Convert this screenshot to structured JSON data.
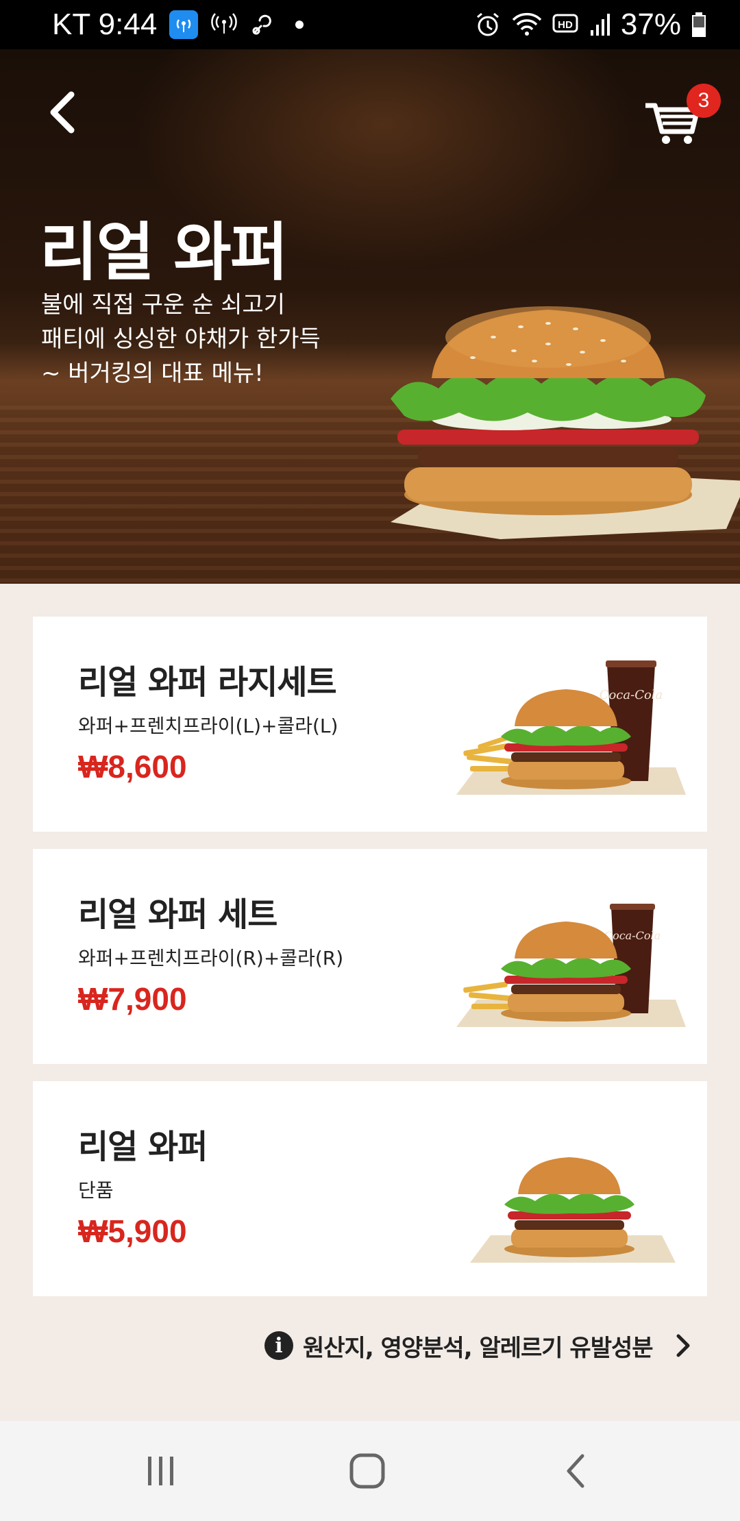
{
  "status_bar": {
    "carrier_time": "KT 9:44",
    "battery": "37%"
  },
  "header": {
    "cart_count": "3"
  },
  "hero": {
    "title": "리얼 와퍼",
    "description": [
      "불에 직접 구운 순 쇠고기",
      "패티에 싱싱한 야채가 한가득",
      "~ 버거킹의 대표 메뉴!"
    ]
  },
  "menu": [
    {
      "name": "리얼 와퍼 라지세트",
      "sub": "와퍼+프렌치프라이(L)+콜라(L)",
      "price": "₩8,600",
      "image": "large-set"
    },
    {
      "name": "리얼 와퍼 세트",
      "sub": "와퍼+프렌치프라이(R)+콜라(R)",
      "price": "₩7,900",
      "image": "set"
    },
    {
      "name": "리얼 와퍼",
      "sub": "단품",
      "price": "₩5,900",
      "image": "single"
    }
  ],
  "info_link": {
    "label": "원산지, 영양분석, 알레르기 유발성분"
  },
  "colors": {
    "accent_red": "#d8261e",
    "badge_red": "#e0261e",
    "background": "#f2ebe6"
  }
}
